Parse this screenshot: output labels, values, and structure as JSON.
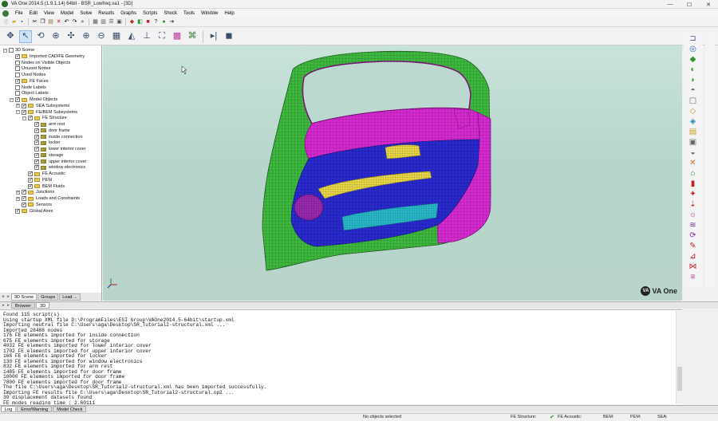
{
  "window": {
    "title": "VA One 2014.5 (1.9.1.14) 64bit - BSR_Lowfreq.va1 - [3D]",
    "minimize": "—",
    "maximize": "☐",
    "close": "✕"
  },
  "menu": [
    "File",
    "Edit",
    "View",
    "Model",
    "Solve",
    "Results",
    "Graphs",
    "Scripts",
    "Shock",
    "Tools",
    "Window",
    "Help"
  ],
  "tree": {
    "items": [
      {
        "label": "3D Scene",
        "level": 0,
        "exp": "-",
        "chk": false,
        "icon": "none"
      },
      {
        "label": "Imported CAD/FE Geometry",
        "level": 1,
        "exp": "",
        "chk": true,
        "icon": "folder"
      },
      {
        "label": "Nodes on Visible Objects",
        "level": 1,
        "exp": "",
        "chk": false,
        "icon": "none"
      },
      {
        "label": "Unused Nodes",
        "level": 1,
        "exp": "",
        "chk": false,
        "icon": "none"
      },
      {
        "label": "Used Nodes",
        "level": 1,
        "exp": "",
        "chk": false,
        "icon": "none"
      },
      {
        "label": "FE Faces",
        "level": 1,
        "exp": "",
        "chk": true,
        "icon": "folder"
      },
      {
        "label": "Node Labels",
        "level": 1,
        "exp": "",
        "chk": false,
        "icon": "none"
      },
      {
        "label": "Object Labels",
        "level": 1,
        "exp": "",
        "chk": false,
        "icon": "none"
      },
      {
        "label": "Model Objects",
        "level": 1,
        "exp": "-",
        "chk": true,
        "icon": "folder"
      },
      {
        "label": "SEA Subsystems",
        "level": 2,
        "exp": "+",
        "chk": true,
        "icon": "folder"
      },
      {
        "label": "FE/BEM Subsystems",
        "level": 2,
        "exp": "-",
        "chk": true,
        "icon": "folder"
      },
      {
        "label": "FE Structure",
        "level": 3,
        "exp": "-",
        "chk": true,
        "icon": "folder"
      },
      {
        "label": "arm rest",
        "level": 4,
        "exp": "",
        "chk": true,
        "icon": "part"
      },
      {
        "label": "door frame",
        "level": 4,
        "exp": "",
        "chk": true,
        "icon": "part"
      },
      {
        "label": "inside connection",
        "level": 4,
        "exp": "",
        "chk": true,
        "icon": "part"
      },
      {
        "label": "locker",
        "level": 4,
        "exp": "",
        "chk": true,
        "icon": "part"
      },
      {
        "label": "lower interior cover",
        "level": 4,
        "exp": "",
        "chk": true,
        "icon": "part"
      },
      {
        "label": "storage",
        "level": 4,
        "exp": "",
        "chk": true,
        "icon": "part"
      },
      {
        "label": "upper interior cover",
        "level": 4,
        "exp": "",
        "chk": true,
        "icon": "part"
      },
      {
        "label": "window electronics",
        "level": 4,
        "exp": "",
        "chk": true,
        "icon": "part"
      },
      {
        "label": "FE Acoustic",
        "level": 3,
        "exp": "",
        "chk": true,
        "icon": "folder"
      },
      {
        "label": "PEM",
        "level": 3,
        "exp": "",
        "chk": true,
        "icon": "folder"
      },
      {
        "label": "BEM Fluids",
        "level": 3,
        "exp": "",
        "chk": true,
        "icon": "folder"
      },
      {
        "label": "Junctions",
        "level": 2,
        "exp": "+",
        "chk": true,
        "icon": "folder"
      },
      {
        "label": "Loads and Constraints",
        "level": 2,
        "exp": "+",
        "chk": true,
        "icon": "folder"
      },
      {
        "label": "Sensors",
        "level": 2,
        "exp": "",
        "chk": true,
        "icon": "folder"
      },
      {
        "label": "Global Axes",
        "level": 1,
        "exp": "",
        "chk": true,
        "icon": "folder"
      }
    ],
    "tabs": [
      "3D Scene",
      "Groups",
      "Load ..."
    ]
  },
  "browser_tabs": [
    "Browser",
    "3D"
  ],
  "log": {
    "lines": [
      "Found 115 script(s)",
      "Using startup XML file D:\\ProgramFiles\\ESI Group\\VAOne2014.5-64bit\\startup.xml",
      "Importing neutral file C:\\Users\\aga\\Desktop\\SR_Tutorial2-structural.xml ...",
      "Imported 28488 nodes",
      "176 FE elements imported for inside connection",
      "675 FE elements imported for storage",
      "4032 FE elements imported for lower interior cover",
      "1702 FE elements imported for upper interior cover",
      "168 FE elements imported for locker",
      "130 FE elements imported for window electronics",
      "832 FE elements imported for arm rest",
      "1485 FE elements imported for door frame",
      "10000 FE elements imported for door frame",
      "7800 FE elements imported for door frame",
      "The file C:\\Users\\aga\\Desktop\\SR_Tutorial2-structural.xml has been imported successfully.",
      "Importing FE results file C:\\Users\\aga\\Desktop\\SR_Tutorial2-structural.op2 ...",
      "30 displacement datasets found",
      "FE modes reading time : 2.60111"
    ],
    "tabs": [
      "Log",
      "Error/Warning",
      "Model Check"
    ]
  },
  "status": {
    "message": "No objects selected",
    "fe_structure": "FE Structure:",
    "fe_acoustic": "FE Acoustic:",
    "bem": "BEM:",
    "pem": "PEM:",
    "sea": "SEA:"
  },
  "logo": {
    "badge": "VA",
    "text": "VA One"
  },
  "colors": {
    "viewport_bg": "#c1ddd3",
    "mesh_green": "#3fb83f",
    "mesh_magenta": "#d62bd1",
    "mesh_blue": "#2a2ad0",
    "mesh_yellow": "#e8d84a",
    "mesh_cyan": "#2ab8c8",
    "mesh_purple": "#9a2ab0"
  }
}
